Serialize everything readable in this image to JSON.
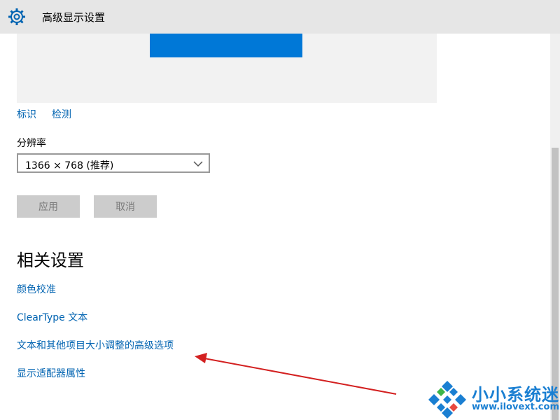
{
  "window": {
    "title": "高级显示设置",
    "icon": "gear-icon"
  },
  "preview": {
    "monitor_color": "#0078d7"
  },
  "display_links": {
    "identify": "标识",
    "detect": "检测"
  },
  "resolution": {
    "label": "分辨率",
    "selected": "1366 × 768 (推荐)"
  },
  "buttons": {
    "apply": "应用",
    "cancel": "取消"
  },
  "related": {
    "heading": "相关设置",
    "links": [
      "颜色校准",
      "ClearType 文本",
      "文本和其他项目大小调整的高级选项",
      "显示适配器属性"
    ]
  },
  "watermark": {
    "title": "小小系统迷",
    "url": "www.ilovext.com"
  },
  "colors": {
    "accent": "#0078d7",
    "link": "#0063b1",
    "annotation_arrow": "#d32020"
  }
}
